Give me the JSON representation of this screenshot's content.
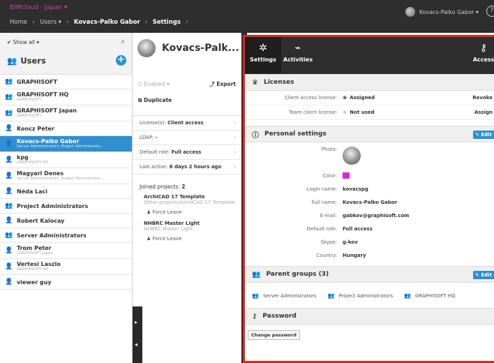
{
  "topbar": {
    "brand": "BIMcloud - Japan ▾",
    "crumbs": [
      "Home",
      "Users ▾",
      "Kovacs-Palko Gabor",
      "Settings"
    ],
    "user_menu": "Kovacs-Palko Gabor ▾",
    "help": "?"
  },
  "left": {
    "show_all": "✔ Show all ▾",
    "title": "Users",
    "items": [
      {
        "name": "GRAPHISOFT",
        "sub": "",
        "icon": "group-icon"
      },
      {
        "name": "GRAPHISOFT HQ",
        "sub": "GRAPHISOFT",
        "icon": "group-icon"
      },
      {
        "name": "GRAPHISOFT Japan",
        "sub": "GRAPHISOFT",
        "icon": "group-icon"
      },
      {
        "name": "Koncz Péter",
        "sub": "",
        "icon": "user-icon"
      },
      {
        "name": "Kovacs-Palko Gabor",
        "sub": "Server Administrators, Project Administrato...",
        "icon": "user-icon",
        "selected": true
      },
      {
        "name": "kpg",
        "sub": "GRAPHISOFT HQ",
        "icon": "user-icon"
      },
      {
        "name": "Magyari Denes",
        "sub": "Server Administrators, Project Administrato...",
        "icon": "user-icon"
      },
      {
        "name": "Néda Laci",
        "sub": "",
        "icon": "user-icon"
      },
      {
        "name": "Project Administrators",
        "sub": "",
        "icon": "group-icon"
      },
      {
        "name": "Robert Kalocay",
        "sub": "",
        "icon": "user-icon"
      },
      {
        "name": "Server Administrators",
        "sub": "",
        "icon": "group-icon"
      },
      {
        "name": "Trom Peter",
        "sub": "GRAPHISOFT Japan",
        "icon": "user-icon"
      },
      {
        "name": "Vertesi Laszlo",
        "sub": "GRAPHISOFT HQ",
        "icon": "user-icon"
      },
      {
        "name": "viewer guy",
        "sub": "",
        "icon": "user-icon"
      }
    ]
  },
  "mid": {
    "name": "Kovacs-Palk...",
    "enabled": "Enabled ▾",
    "export": "Export",
    "duplicate": "Duplicate",
    "meta": [
      {
        "label": "License(s):",
        "value": "Client access"
      },
      {
        "label": "LDAP:",
        "value": "-"
      },
      {
        "label": "Default role:",
        "value": "Full access"
      },
      {
        "label": "Last active:",
        "value": "6 days 2 hours ago"
      }
    ],
    "joined_label": "Joined projects:",
    "joined_count": "2",
    "projects": [
      {
        "name": "ArchiCAD 17 Template",
        "path": "Other projects/ArchiCAD 17 Template",
        "action": "Force Leave"
      },
      {
        "name": "NHBRC Master Light",
        "path": "NHBRC Master Light",
        "action": "Force Leave"
      }
    ]
  },
  "right": {
    "tabs": [
      {
        "label": "Settings",
        "icon": "gear-icon",
        "glyph": "✲"
      },
      {
        "label": "Activities",
        "icon": "activity-icon",
        "glyph": "⌁"
      },
      {
        "label": "Access",
        "icon": "key-icon",
        "glyph": "⚷"
      }
    ],
    "licenses": {
      "title": "Licenses",
      "rows": [
        {
          "label": "Client access license:",
          "value": "Assigned",
          "action": "Revoke"
        },
        {
          "label": "Team client license:",
          "value": "Not used",
          "action": "Assign"
        }
      ]
    },
    "personal": {
      "title": "Personal settings",
      "edit": "✎ Edit",
      "photo_label": "Photo:",
      "color_label": "Color:",
      "color_value": "#e91ee6",
      "fields": [
        {
          "label": "Login name:",
          "value": "kovacspg"
        },
        {
          "label": "Full name:",
          "value": "Kovacs-Palko Gabor"
        },
        {
          "label": "E-mail:",
          "value": "gabkov@graphisoft.com"
        },
        {
          "label": "Default role:",
          "value": "Full access"
        },
        {
          "label": "Skype:",
          "value": "g-kov"
        },
        {
          "label": "Country:",
          "value": "Hungary"
        }
      ]
    },
    "parent_groups": {
      "title": "Parent groups (3)",
      "edit": "✎ Edit",
      "groups": [
        "Server Administrators",
        "Project Administrators",
        "GRAPHISOFT HQ"
      ]
    },
    "password": {
      "title": "Password",
      "button": "Change password"
    }
  }
}
